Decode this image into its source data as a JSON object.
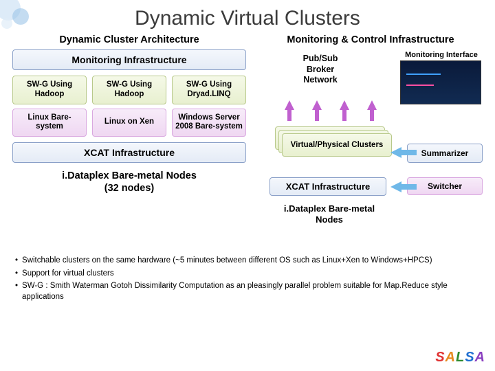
{
  "title": "Dynamic Virtual Clusters",
  "left": {
    "heading": "Dynamic Cluster Architecture",
    "moninfra": "Monitoring Infrastructure",
    "swg": [
      "SW-G Using Hadoop",
      "SW-G Using Hadoop",
      "SW-G Using Dryad.LINQ"
    ],
    "os": [
      "Linux Bare-system",
      "Linux on Xen",
      "Windows Server 2008 Bare-system"
    ],
    "xcat": "XCAT Infrastructure",
    "bare_line1": "i.Dataplex Bare-metal Nodes",
    "bare_line2": "(32 nodes)"
  },
  "right": {
    "heading": "Monitoring & Control Infrastructure",
    "pubsub_l1": "Pub/Sub",
    "pubsub_l2": "Broker",
    "pubsub_l3": "Network",
    "moniface": "Monitoring Interface",
    "clusters": "Virtual/Physical Clusters",
    "summarizer": "Summarizer",
    "xcat": "XCAT Infrastructure",
    "switcher": "Switcher",
    "bare": "i.Dataplex Bare-metal Nodes"
  },
  "bullets": [
    "Switchable clusters on the same hardware (~5 minutes between different OS such as Linux+Xen to Windows+HPCS)",
    "Support for virtual clusters",
    "SW-G : Smith Waterman Gotoh Dissimilarity Computation  as an pleasingly parallel problem suitable for Map.Reduce style applications"
  ],
  "logo": {
    "c": [
      "S",
      "A",
      "L",
      "S",
      "A"
    ]
  }
}
